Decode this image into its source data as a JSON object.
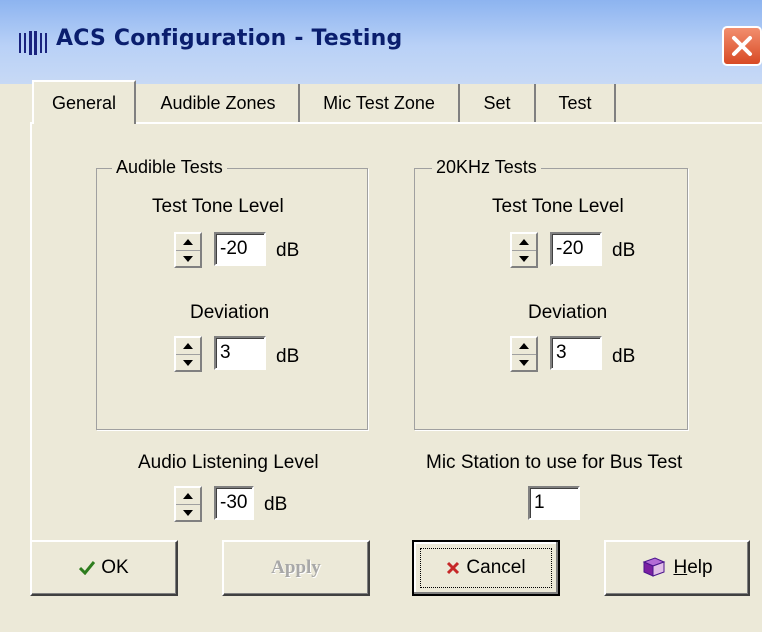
{
  "window": {
    "title": "ACS Configuration - Testing"
  },
  "tabs": [
    {
      "label": "General",
      "active": true
    },
    {
      "label": "Audible Zones",
      "active": false
    },
    {
      "label": "Mic Test Zone",
      "active": false
    },
    {
      "label": "Set",
      "active": false
    },
    {
      "label": "Test",
      "active": false
    }
  ],
  "audible_tests": {
    "legend": "Audible Tests",
    "tone_label": "Test Tone Level",
    "tone_value": "-20",
    "tone_unit": "dB",
    "deviation_label": "Deviation",
    "deviation_value": "3",
    "deviation_unit": "dB"
  },
  "khz_tests": {
    "legend": "20KHz Tests",
    "tone_label": "Test Tone Level",
    "tone_value": "-20",
    "tone_unit": "dB",
    "deviation_label": "Deviation",
    "deviation_value": "3",
    "deviation_unit": "dB"
  },
  "listening": {
    "label": "Audio Listening Level",
    "value": "-30",
    "unit": "dB"
  },
  "mic_station": {
    "label": "Mic Station to use for Bus Test",
    "value": "1"
  },
  "buttons": {
    "ok": "OK",
    "apply": "Apply",
    "cancel": "Cancel",
    "help_prefix": "",
    "help_underlined": "H",
    "help_rest": "elp"
  },
  "colors": {
    "titlebar": "#8DB4F0",
    "title_text": "#0A1E6E",
    "close": "#D84A25",
    "face": "#ECE9D8"
  },
  "icons": {
    "title": "acs-logo-icon",
    "close": "close-icon",
    "ok": "checkmark-icon",
    "cancel": "x-icon",
    "help": "help-book-icon"
  }
}
